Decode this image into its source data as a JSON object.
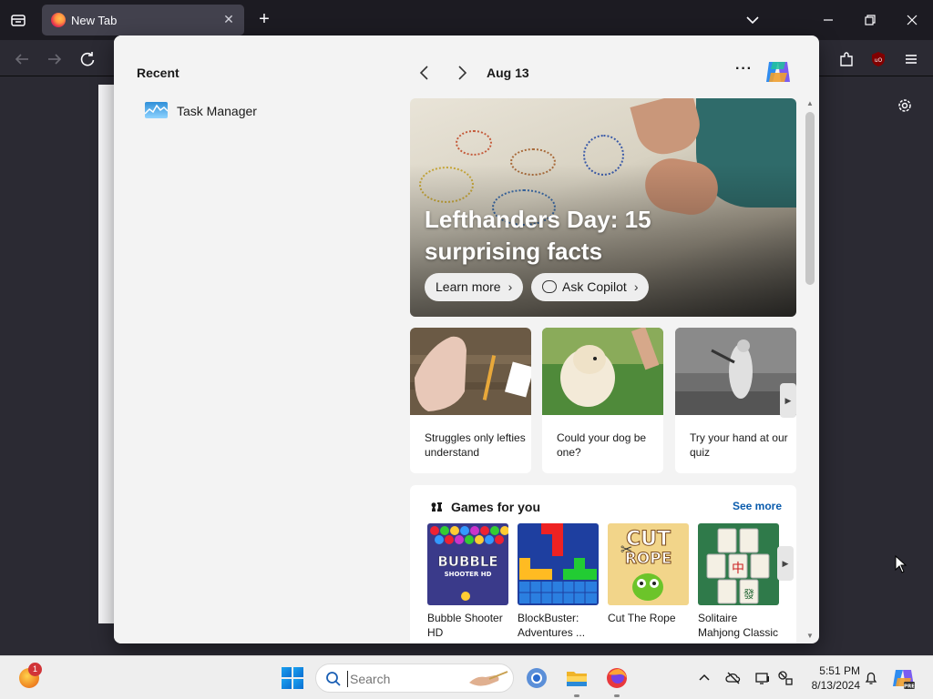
{
  "browser": {
    "tab_title": "New Tab",
    "tab_close": "✕",
    "new_tab": "+"
  },
  "widgets": {
    "recent": {
      "title": "Recent",
      "items": [
        {
          "label": "Task Manager",
          "icon": "task-manager-icon"
        }
      ]
    },
    "feed": {
      "date": "Aug 13",
      "more": "···"
    },
    "hero": {
      "title": "Lefthanders Day: 15 surprising facts",
      "learn_more": "Learn more",
      "ask_copilot": "Ask Copilot"
    },
    "cards": [
      {
        "caption": "Struggles only lefties understand"
      },
      {
        "caption": "Could your dog be one?"
      },
      {
        "caption": "Try your hand at our quiz"
      }
    ],
    "games": {
      "title": "Games for you",
      "see_more": "See more",
      "items": [
        {
          "name": "Bubble Shooter HD",
          "art_text": "BUBBLE",
          "art_sub": "SHOOTER HD"
        },
        {
          "name": "BlockBuster: Adventures ..."
        },
        {
          "name": "Cut The Rope",
          "art_text": "CUT",
          "art_sub": "ROPE"
        },
        {
          "name": "Solitaire Mahjong Classic"
        }
      ]
    }
  },
  "taskbar": {
    "widget_badge": "1",
    "search_placeholder": "Search",
    "time": "5:51 PM",
    "date": "8/13/2024"
  },
  "colors": {
    "accent": "#0b5cad",
    "browser_bg": "#2b2a33",
    "panel_bg": "#f3f3f3"
  }
}
